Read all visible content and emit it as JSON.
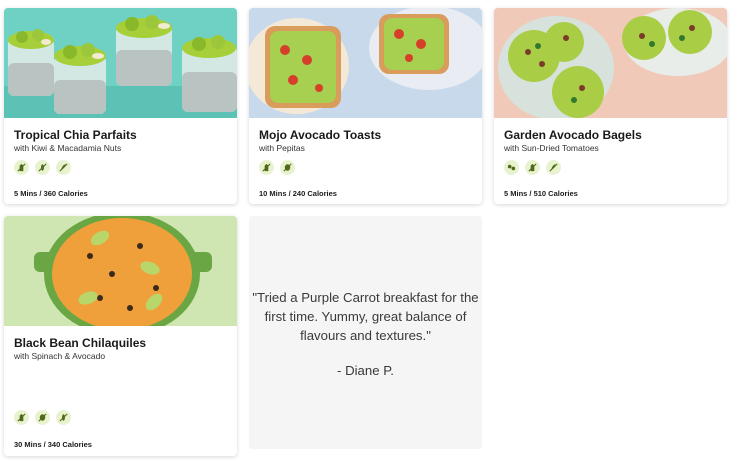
{
  "recipes": [
    {
      "title": "Tropical Chia Parfaits",
      "subtitle": "with Kiwi & Macadamia Nuts",
      "meta": "5 Mins / 360 Calories",
      "badges": [
        "no-dairy-icon",
        "no-gluten-icon",
        "no-soy-icon"
      ]
    },
    {
      "title": "Mojo Avocado Toasts",
      "subtitle": "with Pepitas",
      "meta": "10 Mins / 240 Calories",
      "badges": [
        "no-dairy-icon",
        "no-nuts-icon"
      ]
    },
    {
      "title": "Garden Avocado Bagels",
      "subtitle": "with Sun-Dried Tomatoes",
      "meta": "5 Mins / 510 Calories",
      "badges": [
        "no-nuts-icon",
        "no-dairy-icon",
        "no-soy-icon"
      ]
    },
    {
      "title": "Black Bean Chilaquiles",
      "subtitle": "with Spinach & Avocado",
      "meta": "30 Mins / 340 Calories",
      "badges": [
        "no-dairy-icon",
        "no-nuts-icon",
        "no-gluten-icon"
      ]
    }
  ],
  "testimonial": {
    "quote": "\"Tried a Purple Carrot breakfast for the first time. Yummy, great balance of flavours and textures.\"",
    "author": "- Diane P."
  },
  "colors": {
    "badge_bg": "#e9f2cf",
    "badge_icon": "#4f6a1a",
    "card_bg": "#ffffff",
    "testimonial_bg": "#f5f5f5"
  }
}
